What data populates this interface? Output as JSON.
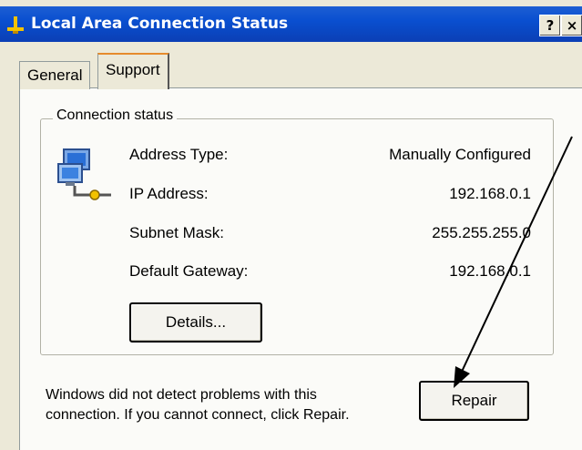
{
  "window": {
    "title": "Local Area Connection Status",
    "help_glyph": "?",
    "close_glyph": "×"
  },
  "tabs": [
    {
      "label": "General",
      "selected": false
    },
    {
      "label": "Support",
      "selected": true
    }
  ],
  "connection_status": {
    "legend": "Connection status",
    "icon": "network-connection-icon",
    "rows": [
      {
        "label": "Address Type:",
        "value": "Manually Configured"
      },
      {
        "label": "IP Address:",
        "value": "192.168.0.1"
      },
      {
        "label": "Subnet Mask:",
        "value": "255.255.255.0"
      },
      {
        "label": "Default Gateway:",
        "value": "192.168.0.1"
      }
    ],
    "details_label": "Details..."
  },
  "message": "Windows did not detect problems with this connection. If you cannot connect, click Repair.",
  "repair_label": "Repair",
  "colors": {
    "titlebar": "#0a4fd0",
    "dialog_bg": "#ece9d8",
    "panel_bg": "#fbfbf8",
    "tab_highlight": "#e68b2c",
    "annotation_arrow": "#000000"
  }
}
